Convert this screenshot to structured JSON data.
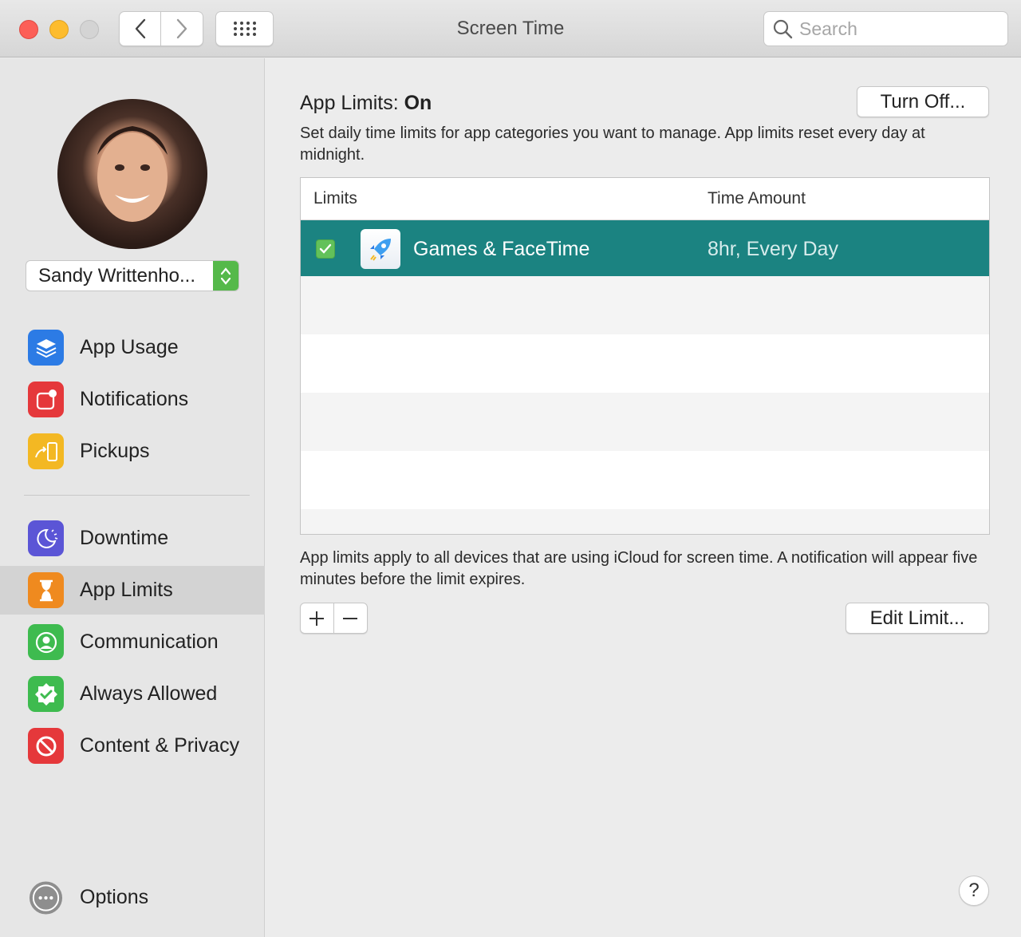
{
  "window": {
    "title": "Screen Time"
  },
  "search": {
    "placeholder": "Search"
  },
  "user": {
    "name": "Sandy Writtenho..."
  },
  "sidebar": {
    "items": [
      {
        "label": "App Usage",
        "icon": "layers-icon",
        "color": "#2c7be5"
      },
      {
        "label": "Notifications",
        "icon": "notification-badge-icon",
        "color": "#e5383b"
      },
      {
        "label": "Pickups",
        "icon": "pickup-phone-icon",
        "color": "#f3b823"
      },
      {
        "label": "Downtime",
        "icon": "downtime-moon-icon",
        "color": "#5b55d6"
      },
      {
        "label": "App Limits",
        "icon": "hourglass-icon",
        "color": "#ef8a1f"
      },
      {
        "label": "Communication",
        "icon": "person-icon",
        "color": "#3ebb4f"
      },
      {
        "label": "Always Allowed",
        "icon": "checkmark-badge-icon",
        "color": "#3ebb4f"
      },
      {
        "label": "Content & Privacy",
        "icon": "block-icon",
        "color": "#e5383b"
      }
    ],
    "options_label": "Options",
    "selected": "App Limits"
  },
  "main": {
    "heading_prefix": "App Limits: ",
    "heading_state": "On",
    "turn_off_label": "Turn Off...",
    "description": "Set daily time limits for app categories you want to manage. App limits reset every day at midnight.",
    "table": {
      "col_limits": "Limits",
      "col_time": "Time Amount",
      "rows": [
        {
          "label": "Games & FaceTime",
          "time": "8hr, Every Day",
          "checked": true
        }
      ]
    },
    "footnote": "App limits apply to all devices that are using iCloud for screen time. A notification will appear five minutes before the limit expires.",
    "add_label": "+",
    "remove_label": "−",
    "edit_limit_label": "Edit Limit...",
    "help_label": "?"
  },
  "colors": {
    "selection": "#1b8381",
    "accent_green": "#55b94a"
  }
}
